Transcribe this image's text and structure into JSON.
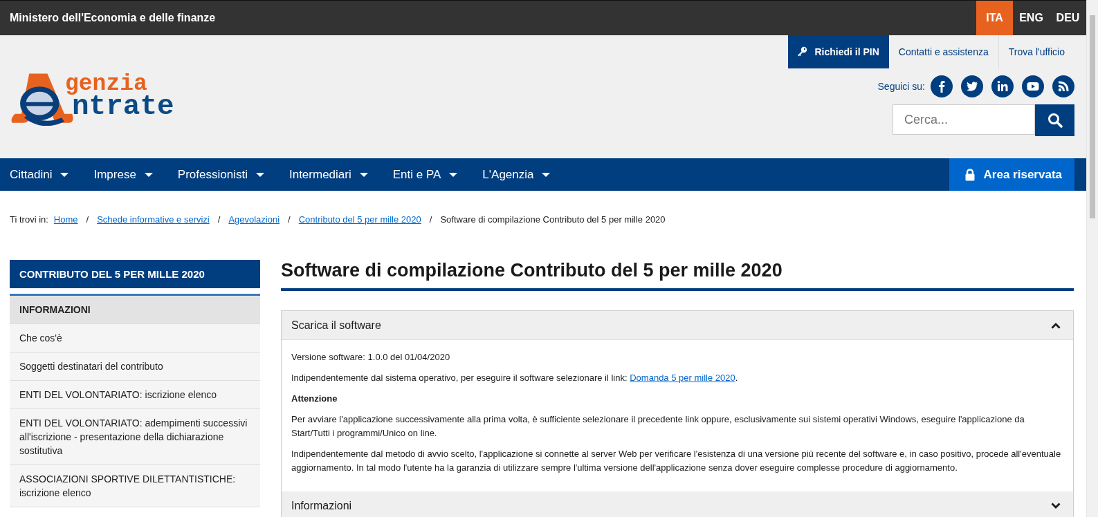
{
  "top_bar": {
    "title": "Ministero dell'Economia e delle finanze",
    "languages": [
      {
        "label": "ITA",
        "selected": true
      },
      {
        "label": "ENG",
        "selected": false
      },
      {
        "label": "DEU",
        "selected": false
      }
    ]
  },
  "header": {
    "logo": {
      "line_1": "genzia",
      "line_2": "ntrate"
    },
    "utility_links": [
      {
        "label": "Richiedi il PIN",
        "kind": "primary"
      },
      {
        "label": "Contatti e assistenza",
        "kind": "link"
      },
      {
        "label": "Trova l'ufficio",
        "kind": "link"
      }
    ],
    "social": {
      "label": "Seguici su:",
      "networks": [
        {
          "kind": "facebook"
        },
        {
          "kind": "twitter"
        },
        {
          "kind": "linkedin"
        },
        {
          "kind": "youtube"
        },
        {
          "kind": "rss"
        }
      ]
    },
    "search": {
      "placeholder": "Cerca..."
    }
  },
  "nav": {
    "items": [
      "Cittadini",
      "Imprese",
      "Professionisti",
      "Intermediari",
      "Enti e PA",
      "L'Agenzia"
    ],
    "reserved_area": "Area riservata"
  },
  "breadcrumb": {
    "label": "Ti trovi in:",
    "separator": "/",
    "links": [
      "Home",
      "Schede informative e servizi",
      "Agevolazioni",
      "Contributo del 5 per mille 2020"
    ],
    "current": "Software di compilazione Contributo del 5 per mille 2020"
  },
  "sidebar": {
    "title": "CONTRIBUTO DEL 5 PER MILLE 2020",
    "items": [
      {
        "label": "INFORMAZIONI",
        "selected": true
      },
      {
        "label": "Che cos'è",
        "selected": false
      },
      {
        "label": "Soggetti destinatari del contributo",
        "selected": false
      },
      {
        "label": "ENTI DEL VOLONTARIATO: iscrizione elenco",
        "selected": false
      },
      {
        "label": "ENTI DEL VOLONTARIATO: adempimenti successivi all'iscrizione - presentazione della dichiarazione sostitutiva",
        "selected": false
      },
      {
        "label": "ASSOCIAZIONI SPORTIVE DILETTANTISTICHE: iscrizione elenco",
        "selected": false
      }
    ]
  },
  "page_title": "Software di compilazione Contributo del 5 per mille 2020",
  "sections": [
    {
      "title": "Scarica il software",
      "expanded": true,
      "content": [
        {
          "kind": "text",
          "text": "Versione software: 1.0.0 del 01/04/2020"
        },
        {
          "kind": "text_link",
          "text": "Indipendentemente dal sistema operativo, per eseguire il software selezionare il link:",
          "link": "Domanda 5 per mille 2020",
          "after": "."
        },
        {
          "kind": "heading",
          "text": "Attenzione"
        },
        {
          "kind": "text",
          "text": "Per avviare l'applicazione successivamente alla prima volta, è sufficiente selezionare il precedente link oppure, esclusivamente sui sistemi operativi Windows, eseguire l'applicazione da Start/Tutti i programmi/Unico on line."
        },
        {
          "kind": "text",
          "text": "Indipendentemente dal metodo di avvio scelto, l'applicazione si connette al server Web per verificare l'esistenza di una versione più recente del software e, in caso positivo, procede all'eventuale aggiornamento. In tal modo l'utente ha la garanzia di utilizzare sempre l'ultima versione dell'applicazione senza dover eseguire complesse procedure di aggiornamento."
        }
      ]
    },
    {
      "title": "Informazioni",
      "expanded": false
    }
  ]
}
